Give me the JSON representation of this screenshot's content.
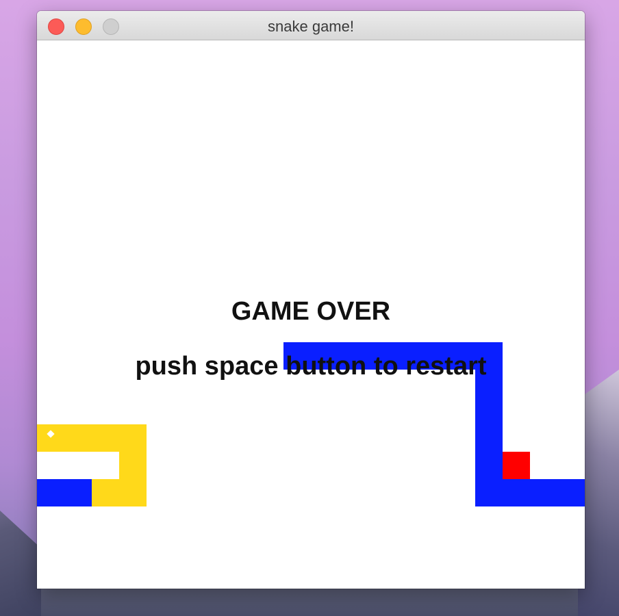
{
  "window": {
    "title": "snake game!",
    "controls": [
      "close",
      "minimize",
      "zoom"
    ]
  },
  "game": {
    "status_text": "GAME OVER",
    "prompt_text": "push space button to restart",
    "colors": {
      "snake_1": "#ffd91a",
      "snake_2": "#0a1fff",
      "food": "#ff0000",
      "background": "#ffffff"
    }
  }
}
